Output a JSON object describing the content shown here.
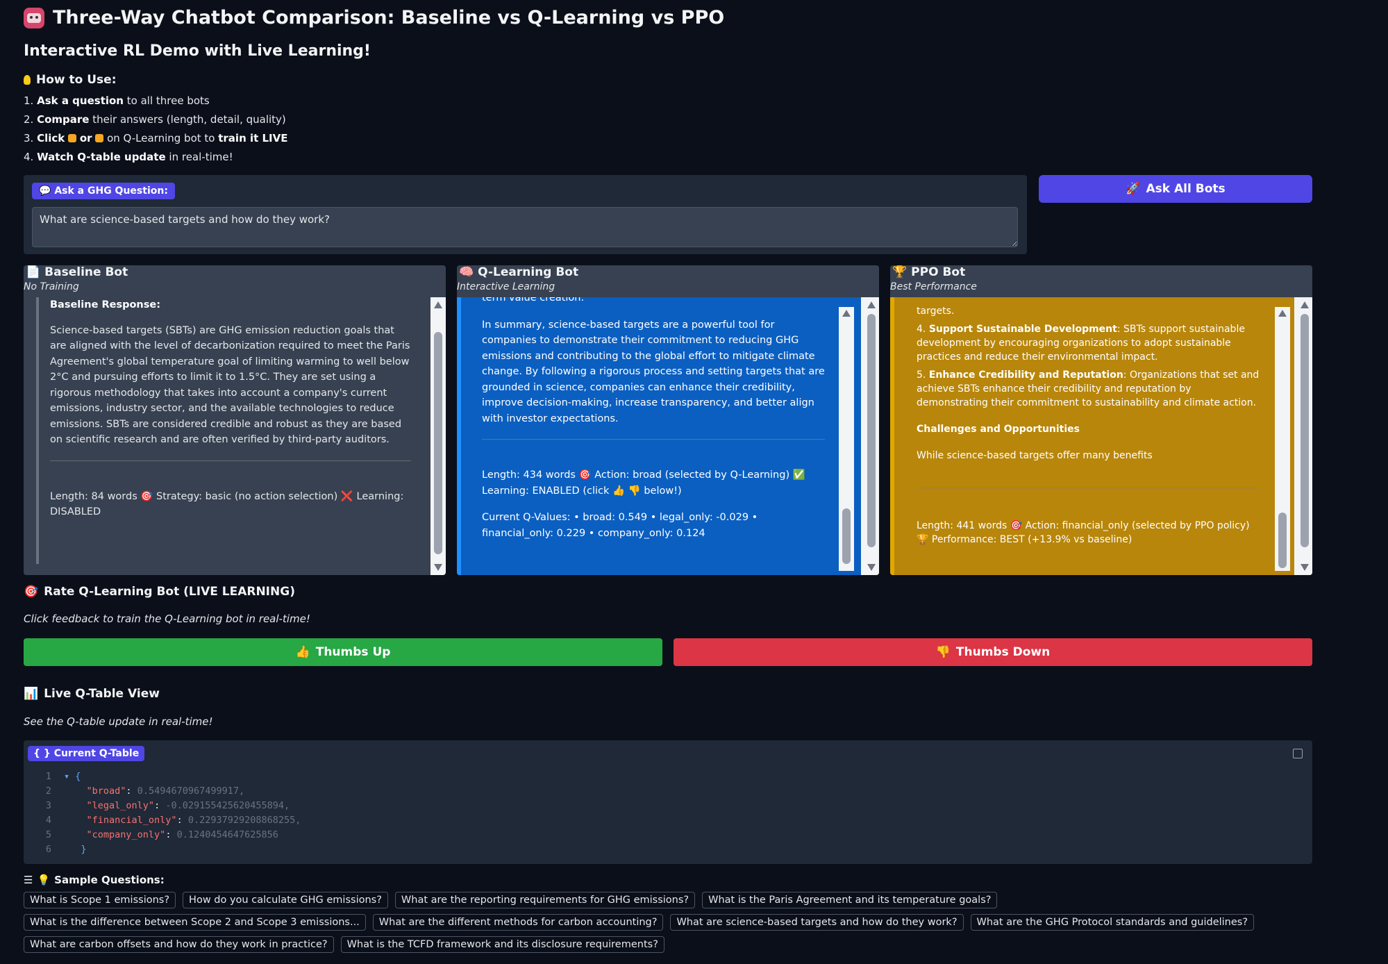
{
  "header": {
    "title": "Three-Way Chatbot Comparison: Baseline vs Q-Learning vs PPO",
    "subtitle": "Interactive RL Demo with Live Learning!"
  },
  "how_to": {
    "title": "How to Use:",
    "steps": [
      {
        "num": "1.",
        "bold": "Ask a question",
        "rest": " to all three bots"
      },
      {
        "num": "2.",
        "bold": "Compare",
        "rest": " their answers (length, detail, quality)"
      },
      {
        "num": "3.",
        "bold": "Click",
        "mid": "or",
        "rest": " on Q-Learning bot to ",
        "bold2": "train it LIVE"
      },
      {
        "num": "4.",
        "bold": "Watch Q-table update",
        "rest": " in real-time!"
      }
    ]
  },
  "question": {
    "label": "Ask a GHG Question:",
    "value": "What are science-based targets and how do they work?",
    "ask_button": "Ask All Bots"
  },
  "bots": {
    "baseline": {
      "name": "Baseline Bot",
      "subtitle": "No Training",
      "response_label": "Baseline Response:",
      "body": "Science-based targets (SBTs) are GHG emission reduction goals that are aligned with the level of decarbonization required to meet the Paris Agreement's global temperature goal of limiting warming to well below 2°C and pursuing efforts to limit it to 1.5°C. They are set using a rigorous methodology that takes into account a company's current emissions, industry sector, and the available technologies to reduce emissions. SBTs are considered credible and robust as they are based on scientific research and are often verified by third-party auditors.",
      "footer": "Length: 84 words 🎯 Strategy: basic (no action selection) ❌ Learning: DISABLED"
    },
    "qlearning": {
      "name": "Q-Learning Bot",
      "subtitle": "Interactive Learning",
      "partial_top": "term value creation.",
      "body": "In summary, science-based targets are a powerful tool for companies to demonstrate their commitment to reducing GHG emissions and contributing to the global effort to mitigate climate change. By following a rigorous process and setting targets that are grounded in science, companies can enhance their credibility, improve decision-making, increase transparency, and better align with investor expectations.",
      "footer": "Length: 434 words 🎯 Action: broad (selected by Q-Learning) ✅ Learning: ENABLED (click 👍 👎 below!)",
      "qvalues": "Current Q-Values: • broad: 0.549 • legal_only: -0.029 • financial_only: 0.229 • company_only: 0.124"
    },
    "ppo": {
      "name": "PPO Bot",
      "subtitle": "Best Performance",
      "partial_top": "targets.",
      "item4_num": "4.",
      "item4_bold": "Support Sustainable Development",
      "item4_rest": ": SBTs support sustainable development by encouraging organizations to adopt sustainable practices and reduce their environmental impact.",
      "item5_num": "5.",
      "item5_bold": "Enhance Credibility and Reputation",
      "item5_rest": ": Organizations that set and achieve SBTs enhance their credibility and reputation by demonstrating their commitment to sustainability and climate action.",
      "section": "Challenges and Opportunities",
      "section_body": "While science-based targets offer many benefits",
      "footer": "Length: 441 words 🎯 Action: financial_only (selected by PPO policy) 🏆 Performance: BEST (+13.9% vs baseline)"
    }
  },
  "rate": {
    "title": "Rate Q-Learning Bot (LIVE LEARNING)",
    "note": "Click feedback to train the Q-Learning bot in real-time!",
    "up": "Thumbs Up",
    "down": "Thumbs Down"
  },
  "qtable": {
    "title": "Live Q-Table View",
    "note": "See the Q-table update in real-time!",
    "label": "Current Q-Table",
    "lines": [
      {
        "n": "1",
        "text": "{"
      },
      {
        "n": "2",
        "key": "\"broad\"",
        "val": "0.5494670967499917,"
      },
      {
        "n": "3",
        "key": "\"legal_only\"",
        "val": "-0.029155425620455894,"
      },
      {
        "n": "4",
        "key": "\"financial_only\"",
        "val": "0.22937929208868255,"
      },
      {
        "n": "5",
        "key": "\"company_only\"",
        "val": "0.1240454647625856"
      },
      {
        "n": "6",
        "text": "}"
      }
    ]
  },
  "samples": {
    "title": "Sample Questions:",
    "items": [
      "What is Scope 1 emissions?",
      "How do you calculate GHG emissions?",
      "What are the reporting requirements for GHG emissions?",
      "What is the Paris Agreement and its temperature goals?",
      "What is the difference between Scope 2 and Scope 3 emissions...",
      "What are the different methods for carbon accounting?",
      "What are science-based targets and how do they work?",
      "What are the GHG Protocol standards and guidelines?",
      "What are carbon offsets and how do they work in practice?",
      "What is the TCFD framework and its disclosure requirements?"
    ]
  },
  "colors": {
    "background": "#0b0f19",
    "accent": "#4f46e5",
    "qlearning_bg": "#0b5fc1",
    "ppo_bg": "#b8860b",
    "thumbs_up": "#28a745",
    "thumbs_down": "#dc3545"
  }
}
